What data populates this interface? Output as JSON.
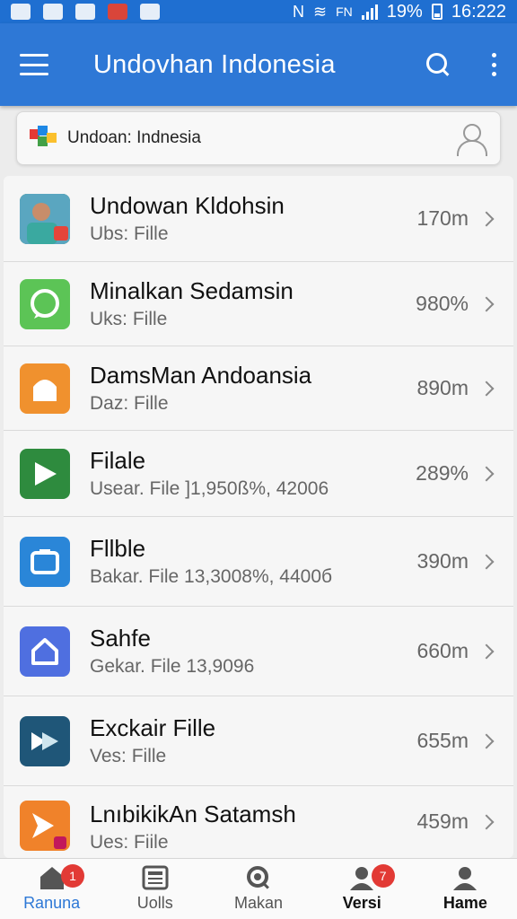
{
  "status_bar": {
    "network_label": "FN",
    "battery_percent": "19%",
    "time": "16:222"
  },
  "app_bar": {
    "title": "Undovhan Indonesia"
  },
  "search": {
    "text": "Undoan: Indnesia"
  },
  "list": {
    "items": [
      {
        "title": "Undowan Kldohsin",
        "subtitle": "Ubs: Fille",
        "value": "170m",
        "icon": "person-photo-icon",
        "color": "#3a8f5a"
      },
      {
        "title": "Minalkan Sedamsin",
        "subtitle": "Uks: Fille",
        "value": "980%",
        "icon": "chat-bubble-icon",
        "color": "#5cc456"
      },
      {
        "title": "DamsMan Andoansia",
        "subtitle": "Daz: Fille",
        "value": "890m",
        "icon": "tent-icon",
        "color": "#f0912e"
      },
      {
        "title": "Filale",
        "subtitle": "Usear. File ]1,950ß%, 42006",
        "value": "289%",
        "icon": "play-icon",
        "color": "#2e8b3e"
      },
      {
        "title": "Fllble",
        "subtitle": "Bakar. File 13,3008%, 4400б",
        "value": "390m",
        "icon": "window-icon",
        "color": "#2a86d8"
      },
      {
        "title": "Sahfe",
        "subtitle": "Gekar. File 13,9096",
        "value": "660m",
        "icon": "home-icon",
        "color": "#4f6fe0"
      },
      {
        "title": "Exckair Fille",
        "subtitle": "Ves: Fille",
        "value": "655m",
        "icon": "forward-icon",
        "color": "#1f5678"
      },
      {
        "title": "LnıbikikAn Satamsh",
        "subtitle": "Ues: Fiile",
        "value": "459m",
        "icon": "arrow-icon",
        "color": "#f0822a"
      }
    ]
  },
  "bottom_nav": {
    "items": [
      {
        "label": "Ranuna",
        "badge": "1",
        "icon": "home-icon"
      },
      {
        "label": "Uolls",
        "badge": "",
        "icon": "news-icon"
      },
      {
        "label": "Makan",
        "badge": "",
        "icon": "search-icon"
      },
      {
        "label": "Versi",
        "badge": "7",
        "icon": "person-icon"
      },
      {
        "label": "Hame",
        "badge": "",
        "icon": "person-icon"
      }
    ]
  }
}
